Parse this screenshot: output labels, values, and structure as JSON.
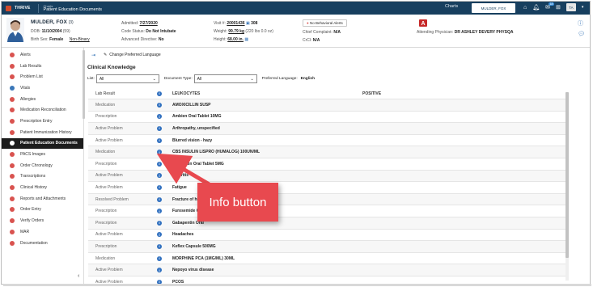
{
  "app": {
    "name": "THRIVE",
    "breadcrumb_parent": "Charts",
    "breadcrumb_current": "Patient Education Documents",
    "charts_link": "Charts",
    "open_tab": "MULDER, FOX",
    "notification_count": "18",
    "user_initials": "TA"
  },
  "patient": {
    "name": "MULDER, FOX",
    "age": "(3)",
    "dob_label": "DOB:",
    "dob": "11/10/2004",
    "dob_age": "(59)",
    "birth_sex_label": "Birth Sex:",
    "birth_sex": "Female",
    "gender": "Non-Binary",
    "admitted_label": "Admitted:",
    "admitted": "7/27/2020",
    "code_status_label": "Code Status:",
    "code_status": "Do Not Intubate",
    "adv_directive_label": "Advanced Directive:",
    "adv_directive": "No",
    "visit_label": "Visit #:",
    "visit": "20001436",
    "room": "308",
    "weight_label": "Weight:",
    "weight": "99.79 kg",
    "weight_alt": "(220 lbs 0.0 oz)",
    "height_label": "Height:",
    "height": "68.00 in.",
    "chief_complaint_label": "Chief Complaint:",
    "chief_complaint": "N/A",
    "crcl_label": "CrCl:",
    "crcl": "N/A",
    "behavior_alerts": "No Behavioral Alerts",
    "attending_label": "Attending Physician:",
    "attending": "DR ASHLEY DEVERY PHYSQA"
  },
  "sidebar": {
    "items": [
      {
        "label": "Alerts",
        "color": "#d9534f"
      },
      {
        "label": "Lab Results",
        "color": "#d9534f"
      },
      {
        "label": "Problem List",
        "color": "#d9534f"
      },
      {
        "label": "Vitals",
        "color": "#3a77b8"
      },
      {
        "label": "Allergies",
        "color": "#d9534f"
      },
      {
        "label": "Medication Reconciliation",
        "color": "#d9534f"
      },
      {
        "label": "Prescription Entry",
        "color": "#d9534f"
      },
      {
        "label": "Patient Immunization History",
        "color": "#d9534f"
      },
      {
        "label": "Patient Education Documents",
        "color": "#3a77b8"
      },
      {
        "label": "PACS Images",
        "color": "#d9534f"
      },
      {
        "label": "Order Chronology",
        "color": "#d9534f"
      },
      {
        "label": "Transcriptions",
        "color": "#d9534f"
      },
      {
        "label": "Clinical History",
        "color": "#d9534f"
      },
      {
        "label": "Reports and Attachments",
        "color": "#d9534f"
      },
      {
        "label": "Order Entry",
        "color": "#d9534f"
      },
      {
        "label": "Verify Orders",
        "color": "#d9534f"
      },
      {
        "label": "MAR",
        "color": "#d9534f"
      },
      {
        "label": "Documentation",
        "color": "#d9534f"
      }
    ],
    "active_index": 8
  },
  "toolbar": {
    "change_language": "Change Preferred Language"
  },
  "clinical": {
    "title": "Clinical Knowledge",
    "list_label": "List:",
    "list_value": "All",
    "doc_type_label": "Document Type:",
    "doc_type_value": "All",
    "pref_lang_label": "Preferred Language:",
    "pref_lang_value": "English",
    "header": {
      "type": "Lab Result",
      "desc": "LEUKOCYTES",
      "result": "POSITIVE"
    },
    "rows": [
      {
        "type": "Medication",
        "desc": "AMOXICILLIN SUSP"
      },
      {
        "type": "Prescription",
        "desc": "Ambien Oral Tablet 10MG"
      },
      {
        "type": "Active Problem",
        "desc": "Arthropathy, unspecified"
      },
      {
        "type": "Active Problem",
        "desc": "Blurred vision - hazy"
      },
      {
        "type": "Medication",
        "desc": "CBS INSULIN LISPRO (HUMALOG) 100UN/ML"
      },
      {
        "type": "Prescription",
        "desc": "Coumadin Oral Tablet 5MG"
      },
      {
        "type": "Active Problem",
        "desc": "Enteritis"
      },
      {
        "type": "Active Problem",
        "desc": "Fatigue"
      },
      {
        "type": "Resolved Problem",
        "desc": "Fracture of hip"
      },
      {
        "type": "Prescription",
        "desc": "Furosemide Oral"
      },
      {
        "type": "Prescription",
        "desc": "Gabapentin Oral"
      },
      {
        "type": "Active Problem",
        "desc": "Headaches"
      },
      {
        "type": "Prescription",
        "desc": "Keflex Capsule 500MG"
      },
      {
        "type": "Medication",
        "desc": "MORPHINE PCA (1MG/ML) 30ML"
      },
      {
        "type": "Active Problem",
        "desc": "Nepoyo virus disease"
      },
      {
        "type": "Active Problem",
        "desc": "PCOS"
      },
      {
        "type": "Active Problem",
        "desc": "Pain in jaw"
      }
    ]
  },
  "callout": {
    "text": "Info button",
    "color": "#e8494f"
  },
  "colors": {
    "topbar": "#173f5f",
    "info_icon": "#2f6fbf",
    "active_sidebar": "#1c1c1c"
  }
}
